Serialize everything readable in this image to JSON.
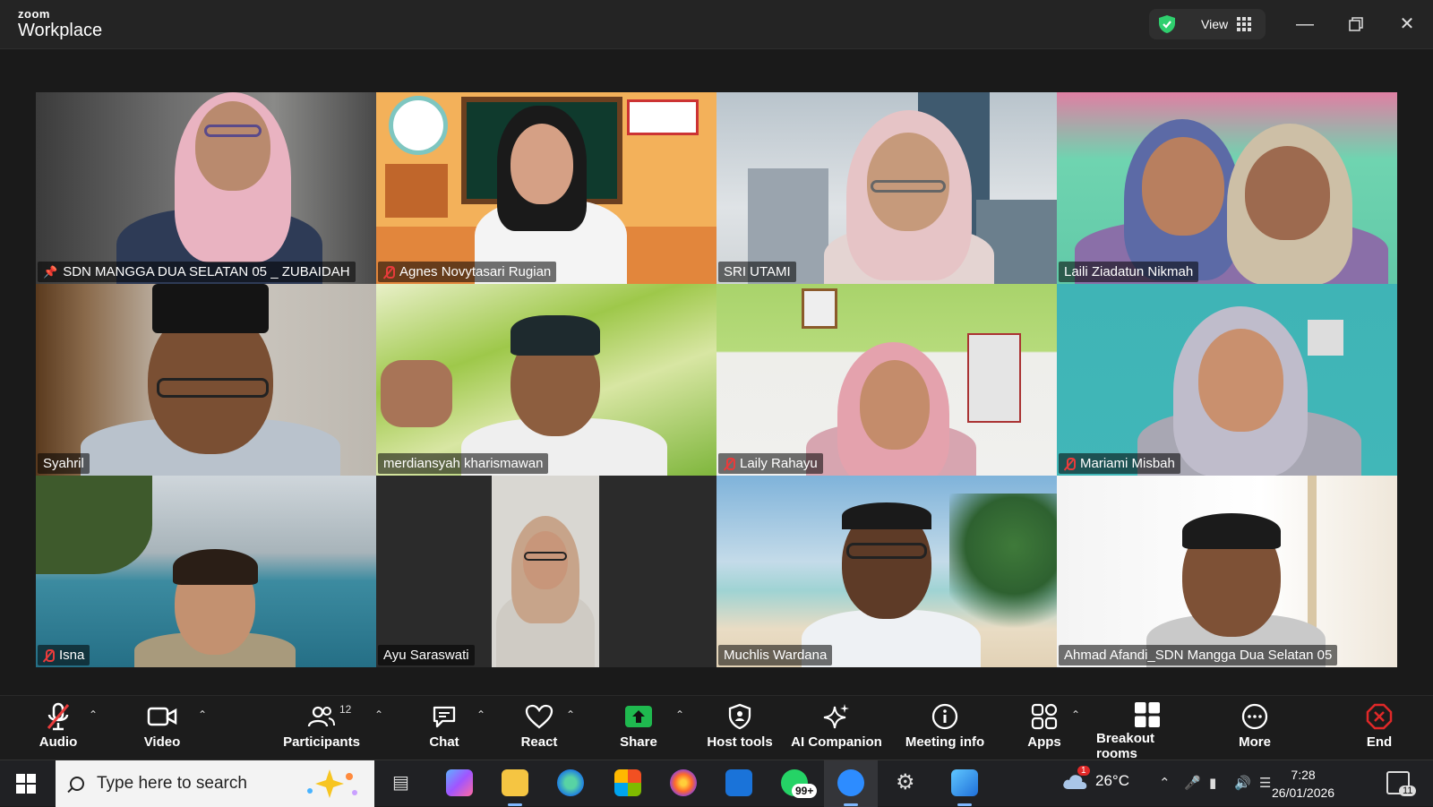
{
  "app": {
    "brand_small": "zoom",
    "brand_big": "Workplace",
    "view_label": "View"
  },
  "participants": [
    {
      "name": "SDN MANGGA DUA SELATAN 05 _ ZUBAIDAH",
      "status": "pinned",
      "active": true
    },
    {
      "name": "Agnes Novytasari Rugian",
      "status": "muted"
    },
    {
      "name": "SRI UTAMI",
      "status": "none"
    },
    {
      "name": "Laili Ziadatun Nikmah",
      "status": "none"
    },
    {
      "name": "Syahril",
      "status": "none"
    },
    {
      "name": "merdiansyah kharismawan",
      "status": "none"
    },
    {
      "name": "Laily Rahayu",
      "status": "muted"
    },
    {
      "name": "Mariami Misbah",
      "status": "muted"
    },
    {
      "name": "Isna",
      "status": "muted"
    },
    {
      "name": "Ayu Saraswati",
      "status": "none"
    },
    {
      "name": "Muchlis Wardana",
      "status": "none"
    },
    {
      "name": "Ahmad Afandi_SDN Mangga Dua Selatan 05",
      "status": "none"
    }
  ],
  "toolbar": {
    "audio": "Audio",
    "video": "Video",
    "participants": "Participants",
    "participants_count": "12",
    "chat": "Chat",
    "react": "React",
    "share": "Share",
    "host_tools": "Host tools",
    "ai_companion": "AI Companion",
    "meeting_info": "Meeting info",
    "apps": "Apps",
    "breakout_rooms": "Breakout rooms",
    "more": "More",
    "end": "End"
  },
  "taskbar": {
    "search_placeholder": "Type here to search",
    "whatsapp_badge": "99+",
    "weather_badge": "1",
    "temperature": "26°C",
    "time": "7:28",
    "date": "26/01/2026",
    "notifications": "11"
  },
  "colors": {
    "active_speaker": "#2fcf6e",
    "share_green": "#1fb94f",
    "end_red": "#e02828",
    "muted_red": "#e83b3b"
  }
}
